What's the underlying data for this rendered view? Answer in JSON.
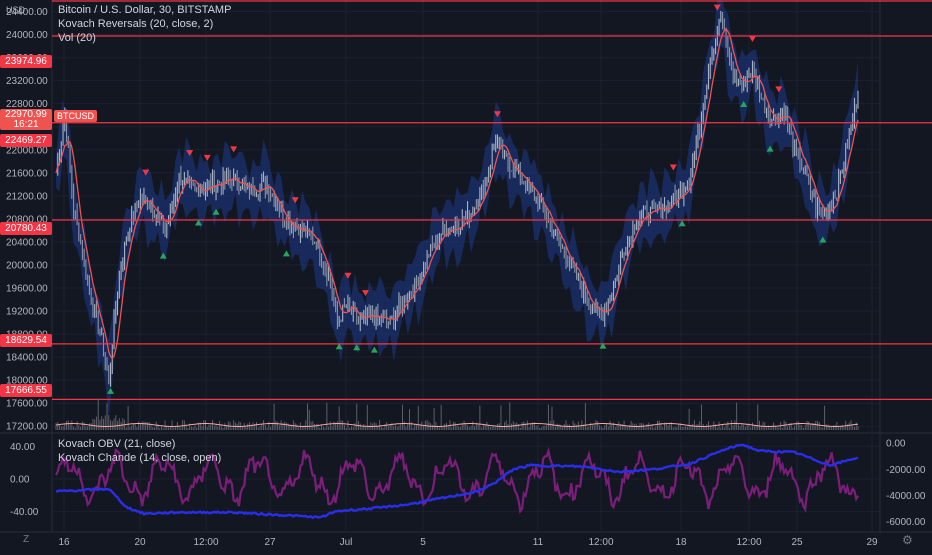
{
  "legend": {
    "main_title": "Bitcoin / U.S. Dollar, 30, BITSTAMP",
    "indicator_1": "Kovach Reversals (20, close, 2)",
    "indicator_2": "Vol (20)",
    "sub_1": "Kovach OBV (21, close)",
    "sub_2": "Kovach Chande (14, close, open)"
  },
  "axis_unit": "USD",
  "price_ticks": [
    "24400.00",
    "24000.00",
    "23600.00",
    "23200.00",
    "22800.00",
    "22400.00",
    "22000.00",
    "21600.00",
    "21200.00",
    "20800.00",
    "20400.00",
    "20000.00",
    "19600.00",
    "19200.00",
    "18800.00",
    "18400.00",
    "18000.00",
    "17600.00",
    "17200.00"
  ],
  "level_lines": [
    "23974.96",
    "22469.27",
    "20780.43",
    "18629.54",
    "17666.55"
  ],
  "last_price": {
    "value": "22970.99",
    "countdown": "16:21",
    "symbol": "BTCUSD"
  },
  "osc_left_ticks": [
    "40.00",
    "0.00",
    "-40.00"
  ],
  "osc_right_ticks": [
    "0.00",
    "-2000.00",
    "-4000.00",
    "-6000.00"
  ],
  "time_labels": [
    "16",
    "20",
    "12:00",
    "27",
    "Jul",
    "5",
    "11",
    "12:00",
    "18",
    "12:00",
    "25",
    "29"
  ],
  "corner": {
    "left": "Z",
    "right": "⚙"
  },
  "colors": {
    "bg": "#131722",
    "level": "#f23645",
    "candle_up": "#a8b4c4",
    "ma": "#ef5350",
    "band": "#1e3a8a",
    "sell": "#f23645",
    "buy": "#26a65b",
    "obv": "#2a2ee8",
    "chande": "#7b1e7a"
  },
  "chart_data": [
    {
      "type": "line",
      "title": "Bitcoin / U.S. Dollar, 30, BITSTAMP",
      "x": [
        "16",
        "20",
        "27",
        "Jul",
        "5",
        "11",
        "18",
        "25",
        "29"
      ],
      "series": [
        {
          "name": "BTCUSD",
          "values": [
            22400,
            18200,
            21500,
            19000,
            20000,
            22500,
            19000,
            24300,
            20800,
            22971
          ]
        }
      ],
      "price_path": [
        [
          0,
          21600
        ],
        [
          5,
          22600
        ],
        [
          10,
          21000
        ],
        [
          15,
          20200
        ],
        [
          20,
          19400
        ],
        [
          26,
          18700
        ],
        [
          30,
          18000
        ],
        [
          35,
          19600
        ],
        [
          40,
          20500
        ],
        [
          48,
          21200
        ],
        [
          55,
          21000
        ],
        [
          62,
          20600
        ],
        [
          70,
          21500
        ],
        [
          80,
          21300
        ],
        [
          90,
          21400
        ],
        [
          100,
          21500
        ],
        [
          110,
          21300
        ],
        [
          120,
          21400
        ],
        [
          130,
          20800
        ],
        [
          140,
          20600
        ],
        [
          148,
          20400
        ],
        [
          155,
          19800
        ],
        [
          160,
          19000
        ],
        [
          165,
          19300
        ],
        [
          172,
          19000
        ],
        [
          180,
          19100
        ],
        [
          190,
          19000
        ],
        [
          198,
          19400
        ],
        [
          205,
          19700
        ],
        [
          212,
          20200
        ],
        [
          220,
          20600
        ],
        [
          228,
          20700
        ],
        [
          236,
          20900
        ],
        [
          244,
          21400
        ],
        [
          250,
          22200
        ],
        [
          256,
          21800
        ],
        [
          262,
          21600
        ],
        [
          270,
          21300
        ],
        [
          278,
          20900
        ],
        [
          286,
          20400
        ],
        [
          294,
          19900
        ],
        [
          302,
          19400
        ],
        [
          310,
          19100
        ],
        [
          316,
          19500
        ],
        [
          322,
          20200
        ],
        [
          330,
          20800
        ],
        [
          338,
          20900
        ],
        [
          346,
          21000
        ],
        [
          354,
          21200
        ],
        [
          360,
          21500
        ],
        [
          366,
          22400
        ],
        [
          372,
          23600
        ],
        [
          378,
          24300
        ],
        [
          384,
          23400
        ],
        [
          390,
          23100
        ],
        [
          396,
          23400
        ],
        [
          402,
          22800
        ],
        [
          408,
          22500
        ],
        [
          414,
          22700
        ],
        [
          420,
          22000
        ],
        [
          426,
          21600
        ],
        [
          432,
          21000
        ],
        [
          438,
          20900
        ],
        [
          444,
          21300
        ],
        [
          450,
          22100
        ],
        [
          456,
          22971
        ]
      ],
      "ylim": [
        17100,
        24600
      ],
      "ylabel": "USD",
      "levels": [
        23974.96,
        22469.27,
        20780.43,
        18629.54,
        17666.55
      ]
    },
    {
      "type": "line",
      "x": [
        "16",
        "20",
        "27",
        "Jul",
        "5",
        "11",
        "18",
        "25",
        "29"
      ],
      "series": [
        {
          "name": "Kovach OBV (21, close)",
          "values": [
            -3700,
            -5400,
            -5300,
            -5600,
            -4200,
            -1800,
            -1600,
            -100,
            -1300
          ]
        },
        {
          "name": "Kovach Chande (14, close, open)",
          "values": [
            0,
            -30,
            20,
            -10,
            30,
            -20,
            10,
            -25,
            -5
          ]
        }
      ],
      "obv_path": [
        [
          0,
          -3700
        ],
        [
          30,
          -3500
        ],
        [
          40,
          -4900
        ],
        [
          50,
          -5400
        ],
        [
          70,
          -5300
        ],
        [
          100,
          -5300
        ],
        [
          140,
          -5600
        ],
        [
          150,
          -5700
        ],
        [
          160,
          -5200
        ],
        [
          180,
          -5000
        ],
        [
          200,
          -4700
        ],
        [
          220,
          -4200
        ],
        [
          240,
          -3700
        ],
        [
          250,
          -3000
        ],
        [
          260,
          -2000
        ],
        [
          270,
          -1700
        ],
        [
          300,
          -1800
        ],
        [
          320,
          -2200
        ],
        [
          340,
          -2000
        ],
        [
          360,
          -1600
        ],
        [
          380,
          -500
        ],
        [
          390,
          -100
        ],
        [
          400,
          -600
        ],
        [
          420,
          -700
        ],
        [
          440,
          -1700
        ],
        [
          456,
          -1100
        ]
      ],
      "left_ylim": [
        -60,
        55
      ],
      "right_ylim": [
        -6500,
        700
      ]
    }
  ]
}
